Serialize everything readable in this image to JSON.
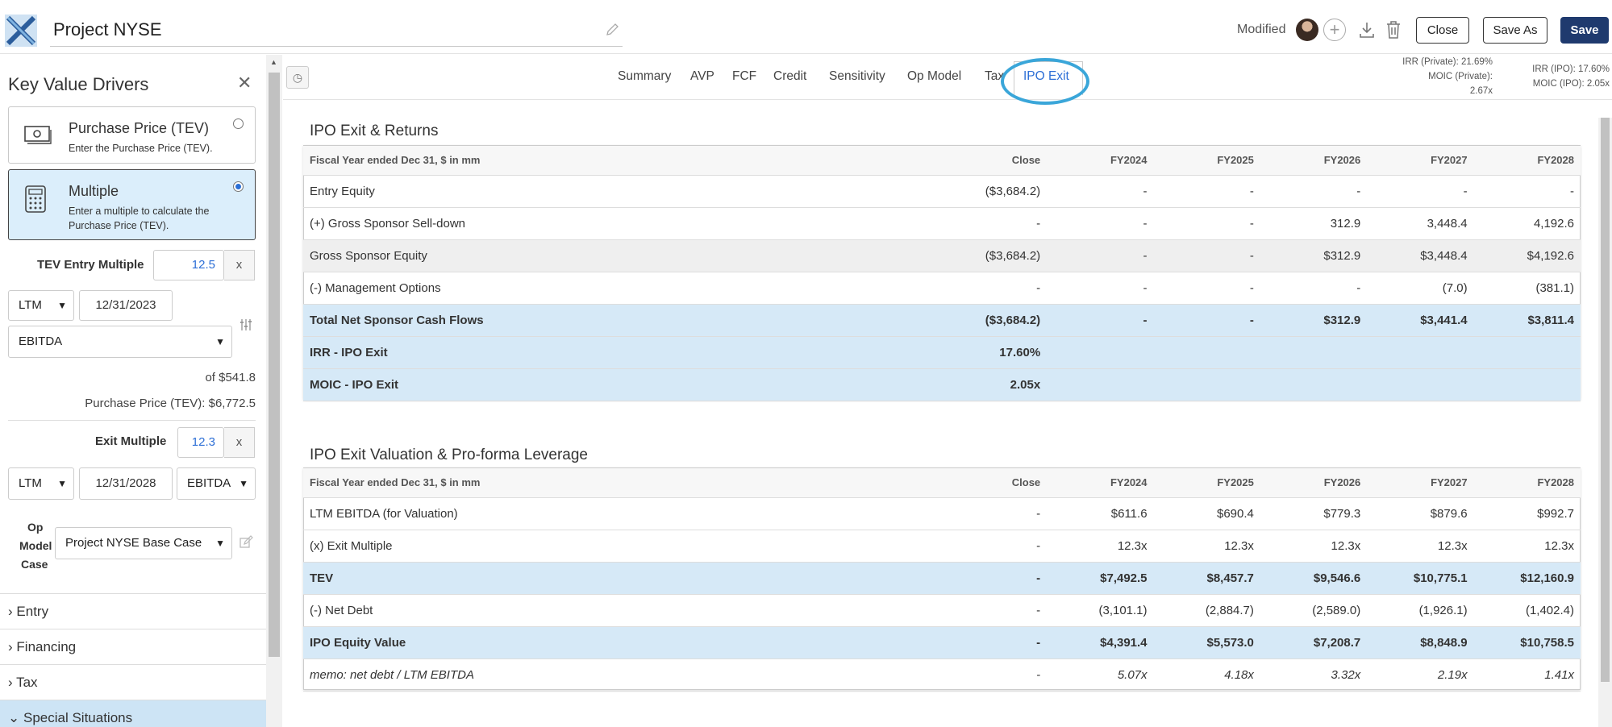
{
  "header": {
    "project_title": "Project NYSE",
    "modified_label": "Modified",
    "close_label": "Close",
    "save_as_label": "Save As",
    "save_label": "Save"
  },
  "sidebar": {
    "title": "Key Value Drivers",
    "options": [
      {
        "title": "Purchase Price (TEV)",
        "desc": "Enter the Purchase Price (TEV).",
        "selected": false
      },
      {
        "title": "Multiple",
        "desc": "Enter a multiple to calculate the Purchase Price (TEV).",
        "selected": true
      }
    ],
    "tev_entry_label": "TEV Entry Multiple",
    "tev_entry_value": "12.5",
    "x_label": "x",
    "entry_period": "LTM",
    "entry_date": "12/31/2023",
    "entry_metric": "EBITDA",
    "of_value": "of $541.8",
    "purchase_price": "Purchase Price (TEV): $6,772.5",
    "exit_multiple_label": "Exit Multiple",
    "exit_multiple_value": "12.3",
    "exit_period": "LTM",
    "exit_date": "12/31/2028",
    "exit_metric": "EBITDA",
    "op_model_label_1": "Op",
    "op_model_label_2": "Model",
    "op_model_label_3": "Case",
    "op_model_case": "Project NYSE Base Case",
    "sections": [
      "Entry",
      "Financing",
      "Tax",
      "Special Situations"
    ]
  },
  "tabs": [
    "Summary",
    "AVP",
    "FCF",
    "Credit",
    "Sensitivity",
    "Op Model",
    "Tax",
    "IPO Exit"
  ],
  "active_tab": "IPO Exit",
  "metrics": {
    "irr_private": "IRR (Private): 21.69%",
    "moic_private": "MOIC (Private):",
    "moic_private_val": "2.67x",
    "irr_ipo": "IRR (IPO): 17.60%",
    "moic_ipo": "MOIC (IPO):  2.05x"
  },
  "returns": {
    "title": "IPO Exit & Returns",
    "columns": [
      "Fiscal Year ended Dec 31, $ in mm",
      "Close",
      "FY2024",
      "FY2025",
      "FY2026",
      "FY2027",
      "FY2028"
    ],
    "rows": [
      {
        "style": "",
        "cells": [
          "Entry Equity",
          "($3,684.2)",
          "-",
          "-",
          "-",
          "-",
          "-"
        ]
      },
      {
        "style": "",
        "cells": [
          "(+) Gross Sponsor Sell-down",
          "-",
          "-",
          "-",
          "312.9",
          "3,448.4",
          "4,192.6"
        ]
      },
      {
        "style": "shade",
        "cells": [
          "Gross Sponsor Equity",
          "($3,684.2)",
          "-",
          "-",
          "$312.9",
          "$3,448.4",
          "$4,192.6"
        ]
      },
      {
        "style": "",
        "cells": [
          "(-) Management Options",
          "-",
          "-",
          "-",
          "-",
          "(7.0)",
          "(381.1)"
        ]
      },
      {
        "style": "blue",
        "cells": [
          "Total Net Sponsor Cash Flows",
          "($3,684.2)",
          "-",
          "-",
          "$312.9",
          "$3,441.4",
          "$3,811.4"
        ]
      },
      {
        "style": "blue",
        "cells": [
          "IRR - IPO Exit",
          "17.60%",
          "",
          "",
          "",
          "",
          ""
        ]
      },
      {
        "style": "blue",
        "cells": [
          "MOIC - IPO Exit",
          "2.05x",
          "",
          "",
          "",
          "",
          ""
        ]
      }
    ]
  },
  "valuation": {
    "title": "IPO Exit Valuation & Pro-forma Leverage",
    "columns": [
      "Fiscal Year ended Dec 31, $ in mm",
      "Close",
      "FY2024",
      "FY2025",
      "FY2026",
      "FY2027",
      "FY2028"
    ],
    "rows": [
      {
        "style": "",
        "cells": [
          "LTM EBITDA (for Valuation)",
          "-",
          "$611.6",
          "$690.4",
          "$779.3",
          "$879.6",
          "$992.7"
        ]
      },
      {
        "style": "",
        "cells": [
          "(x) Exit Multiple",
          "-",
          "12.3x",
          "12.3x",
          "12.3x",
          "12.3x",
          "12.3x"
        ]
      },
      {
        "style": "blue",
        "cells": [
          "TEV",
          "-",
          "$7,492.5",
          "$8,457.7",
          "$9,546.6",
          "$10,775.1",
          "$12,160.9"
        ]
      },
      {
        "style": "",
        "cells": [
          "(-) Net Debt",
          "-",
          "(3,101.1)",
          "(2,884.7)",
          "(2,589.0)",
          "(1,926.1)",
          "(1,402.4)"
        ]
      },
      {
        "style": "blue",
        "cells": [
          "IPO Equity Value",
          "-",
          "$4,391.4",
          "$5,573.0",
          "$7,208.7",
          "$8,848.9",
          "$10,758.5"
        ]
      },
      {
        "style": "memo",
        "cells": [
          "memo: net debt / LTM EBITDA",
          "-",
          "5.07x",
          "4.18x",
          "3.32x",
          "2.19x",
          "1.41x"
        ]
      }
    ]
  },
  "icons": [
    "logo-icon",
    "pencil-icon",
    "avatar",
    "plus-icon",
    "download-icon",
    "trash-icon",
    "close-icon",
    "cash-icon",
    "calculator-icon",
    "sliders-icon",
    "edit-icon",
    "chevron-right-icon",
    "chevron-down-icon",
    "sidebar-toggle-icon"
  ],
  "colors": {
    "accent": "#2d6fd6",
    "save_button": "#1f3a6e",
    "highlight_row": "#d6e9f7",
    "ring": "#3aa6d9"
  }
}
